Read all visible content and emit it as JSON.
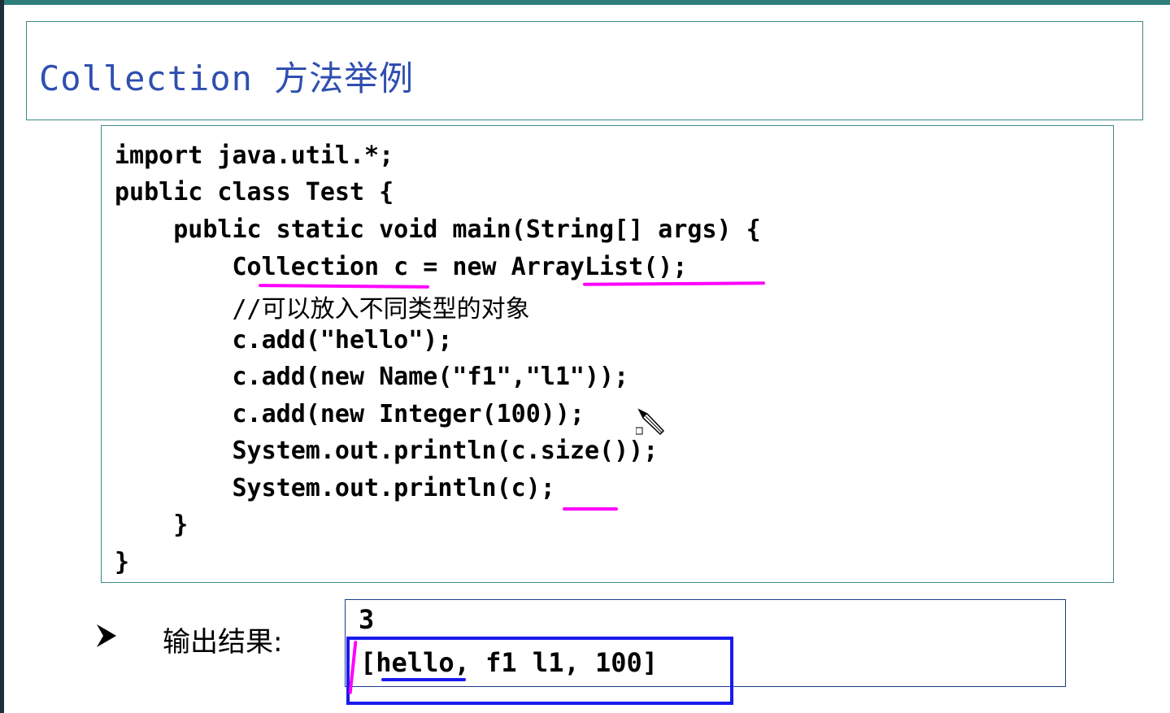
{
  "slide": {
    "title": "Collection 方法举例"
  },
  "code": {
    "lines": [
      "import java.util.*;",
      "public class Test {",
      "    public static void main(String[] args) {",
      "        Collection c = new ArrayList();",
      "        //可以放入不同类型的对象",
      "        c.add(\"hello\");",
      "        c.add(new Name(\"f1\",\"l1\"));",
      "        c.add(new Integer(100));",
      "        System.out.println(c.size());",
      "        System.out.println(c);",
      "    }",
      "}"
    ]
  },
  "output": {
    "bullet_icon": "arrowhead-bullet-icon",
    "label": "输出结果:",
    "line1": "3",
    "line2": "[hello, f1 l1, 100]"
  },
  "annotations": {
    "underline_color": "#ff00ff",
    "box_color": "#1a1aee",
    "cursor_icon": "pen-cursor-icon"
  }
}
